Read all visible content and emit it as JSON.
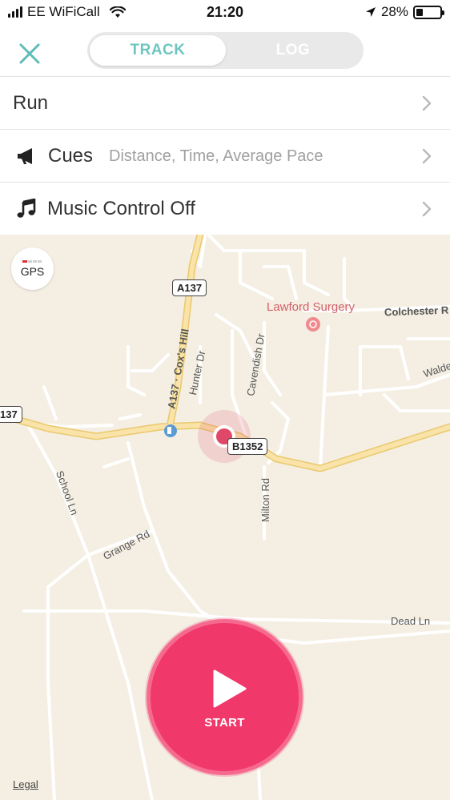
{
  "status_bar": {
    "carrier": "EE WiFiCall",
    "time": "21:20",
    "battery_percent": "28%",
    "battery_level": 0.28
  },
  "header": {
    "tabs": [
      {
        "label": "TRACK",
        "active": true
      },
      {
        "label": "LOG",
        "active": false
      }
    ]
  },
  "rows": {
    "activity": {
      "label": "Run"
    },
    "cues": {
      "label": "Cues",
      "detail": "Distance, Time, Average Pace",
      "icon": "megaphone-icon"
    },
    "music": {
      "label": "Music Control Off",
      "icon": "music-note-icon"
    }
  },
  "map": {
    "gps_label": "GPS",
    "poi": "Lawford Surgery",
    "roads": {
      "a137_shield": "A137",
      "a137_left_shield": "137",
      "b1352_shield": "B1352",
      "coxs_hill": "A137 · Cox's Hill",
      "colchester": "Colchester R",
      "walden": "Walden",
      "hunter": "Hunter Dr",
      "cavendish": "Cavendish Dr",
      "school": "School Ln",
      "grange": "Grange Rd",
      "milton": "Milton Rd",
      "dead": "Dead Ln"
    },
    "legal": "Legal"
  },
  "start_button": {
    "label": "START"
  },
  "colors": {
    "accent_teal": "#6fc6c1",
    "start_pink": "#f0386b",
    "map_bg": "#f5efe3",
    "main_road": "#f7dfa0",
    "location_dot": "#e0486a"
  }
}
